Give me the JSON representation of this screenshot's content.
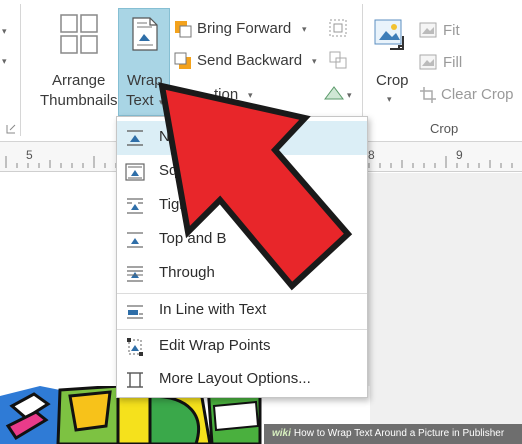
{
  "ribbon": {
    "arrange_thumbnails": {
      "line1": "Arrange",
      "line2": "Thumbnails"
    },
    "wrap_text": {
      "line1": "Wrap",
      "line2": "Text"
    },
    "position_partial": "tion",
    "bring_forward": "Bring Forward",
    "send_backward": "Send Backward",
    "crop": "Crop",
    "fit": "Fit",
    "fill": "Fill",
    "clear_crop": "Clear Crop",
    "crop_group_title": "Crop"
  },
  "ruler": {
    "marks": [
      "5",
      "8",
      "9"
    ]
  },
  "wrap_menu": {
    "items": [
      {
        "label": "None",
        "visible_label": "No",
        "icon": "wrap-none-icon",
        "selected": true
      },
      {
        "label": "Square",
        "visible_label": "Squar",
        "icon": "wrap-square-icon",
        "selected": false
      },
      {
        "label": "Tight",
        "visible_label": "Tight",
        "icon": "wrap-tight-icon",
        "selected": false
      },
      {
        "label": "Top and Bottom",
        "visible_label": "Top and B",
        "visible_label_tail": "m",
        "icon": "wrap-top-bottom-icon",
        "selected": false
      },
      {
        "label": "Through",
        "visible_label": "Through",
        "icon": "wrap-through-icon",
        "selected": false
      },
      {
        "label": "In Line with Text",
        "visible_label": "In Line with Text",
        "icon": "wrap-inline-icon",
        "selected": false
      },
      {
        "label": "Edit Wrap Points",
        "visible_label": "Edit Wrap Points",
        "icon": "edit-wrap-points-icon",
        "selected": false
      },
      {
        "label": "More Layout Options...",
        "visible_label": "More Layout Options...",
        "icon": "more-layout-options-icon",
        "selected": false
      }
    ]
  },
  "watermark": {
    "brand": "wiki",
    "text": "How to Wrap Text Around a Picture in Publisher"
  },
  "colors": {
    "accent_selected": "#a9d5e5",
    "arrow_red": "#e8262a",
    "arrow_outline": "#1a1a1a"
  }
}
